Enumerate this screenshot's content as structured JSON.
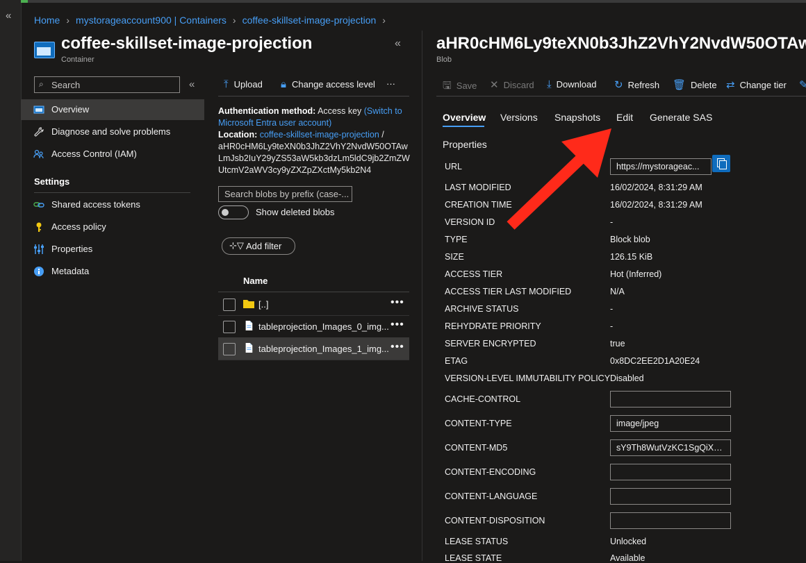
{
  "breadcrumb": [
    "Home",
    "mystorageaccount900 | Containers",
    "coffee-skillset-image-projection"
  ],
  "left_blade": {
    "title": "coffee-skillset-image-projection",
    "subtitle": "Container",
    "search_placeholder": "Search",
    "nav": [
      {
        "label": "Overview",
        "icon": "container-overview-icon",
        "active": true
      },
      {
        "label": "Diagnose and solve problems",
        "icon": "wrench-icon"
      },
      {
        "label": "Access Control (IAM)",
        "icon": "people-icon"
      }
    ],
    "settings_heading": "Settings",
    "settings_nav": [
      {
        "label": "Shared access tokens",
        "icon": "link-chain-icon"
      },
      {
        "label": "Access policy",
        "icon": "key-icon"
      },
      {
        "label": "Properties",
        "icon": "sliders-icon"
      },
      {
        "label": "Metadata",
        "icon": "info-icon"
      }
    ]
  },
  "container_pane": {
    "toolbar": {
      "upload": "Upload",
      "change_access": "Change access level",
      "more": "···"
    },
    "auth_label": "Authentication method:",
    "auth_value": "Access key",
    "auth_switch": "(Switch to Microsoft Entra user account)",
    "location_label": "Location:",
    "location_link": "coffee-skillset-image-projection",
    "location_slash": "/",
    "location_path": "aHR0cHM6Ly9teXN0b3JhZ2VhY2NvdW50OTAwLmJsb2IuY29yZS53aW5kb3dzLm5ldC9jb2ZmZWUtcmV2aWV3cy9yZXZpZXctMy5kb2N4",
    "prefix_placeholder": "Search blobs by prefix (case-...",
    "show_deleted": "Show deleted blobs",
    "add_filter": "Add filter",
    "column_name": "Name",
    "rows": [
      {
        "name": "[..]",
        "type": "folder"
      },
      {
        "name": "tableprojection_Images_0_img...",
        "type": "file"
      },
      {
        "name": "tableprojection_Images_1_img...",
        "type": "file",
        "selected": true
      }
    ],
    "row_more": "•••"
  },
  "blob_pane": {
    "title": "aHR0cHM6Ly9teXN0b3JhZ2VhY2NvdW50OTAwL",
    "subtitle": "Blob",
    "toolbar": {
      "save": "Save",
      "discard": "Discard",
      "download": "Download",
      "refresh": "Refresh",
      "delete": "Delete",
      "change_tier": "Change tier"
    },
    "tabs": [
      "Overview",
      "Versions",
      "Snapshots",
      "Edit",
      "Generate SAS"
    ],
    "properties_heading": "Properties",
    "properties": [
      {
        "label": "URL",
        "value": "https://mystorageac...",
        "kind": "input"
      },
      {
        "label": "LAST MODIFIED",
        "value": "16/02/2024, 8:31:29 AM"
      },
      {
        "label": "CREATION TIME",
        "value": "16/02/2024, 8:31:29 AM"
      },
      {
        "label": "VERSION ID",
        "value": "-"
      },
      {
        "label": "TYPE",
        "value": "Block blob"
      },
      {
        "label": "SIZE",
        "value": "126.15 KiB"
      },
      {
        "label": "ACCESS TIER",
        "value": "Hot (Inferred)"
      },
      {
        "label": "ACCESS TIER LAST MODIFIED",
        "value": "N/A"
      },
      {
        "label": "ARCHIVE STATUS",
        "value": "-"
      },
      {
        "label": "REHYDRATE PRIORITY",
        "value": "-"
      },
      {
        "label": "SERVER ENCRYPTED",
        "value": "true"
      },
      {
        "label": "ETAG",
        "value": "0x8DC2EE2D1A20E24"
      },
      {
        "label": "VERSION-LEVEL IMMUTABILITY POLICY",
        "value": "Disabled"
      },
      {
        "label": "CACHE-CONTROL",
        "value": "",
        "kind": "input"
      },
      {
        "label": "CONTENT-TYPE",
        "value": "image/jpeg",
        "kind": "input"
      },
      {
        "label": "CONTENT-MD5",
        "value": "sY9Th8WutVzKC1SgQiXw...",
        "kind": "input"
      },
      {
        "label": "CONTENT-ENCODING",
        "value": "",
        "kind": "input"
      },
      {
        "label": "CONTENT-LANGUAGE",
        "value": "",
        "kind": "input"
      },
      {
        "label": "CONTENT-DISPOSITION",
        "value": "",
        "kind": "input"
      },
      {
        "label": "LEASE STATUS",
        "value": "Unlocked"
      },
      {
        "label": "LEASE STATE",
        "value": "Available"
      }
    ]
  },
  "colors": {
    "accent": "#479ef5",
    "background": "#1b1a19",
    "annotation_arrow": "#ff2a1a"
  }
}
